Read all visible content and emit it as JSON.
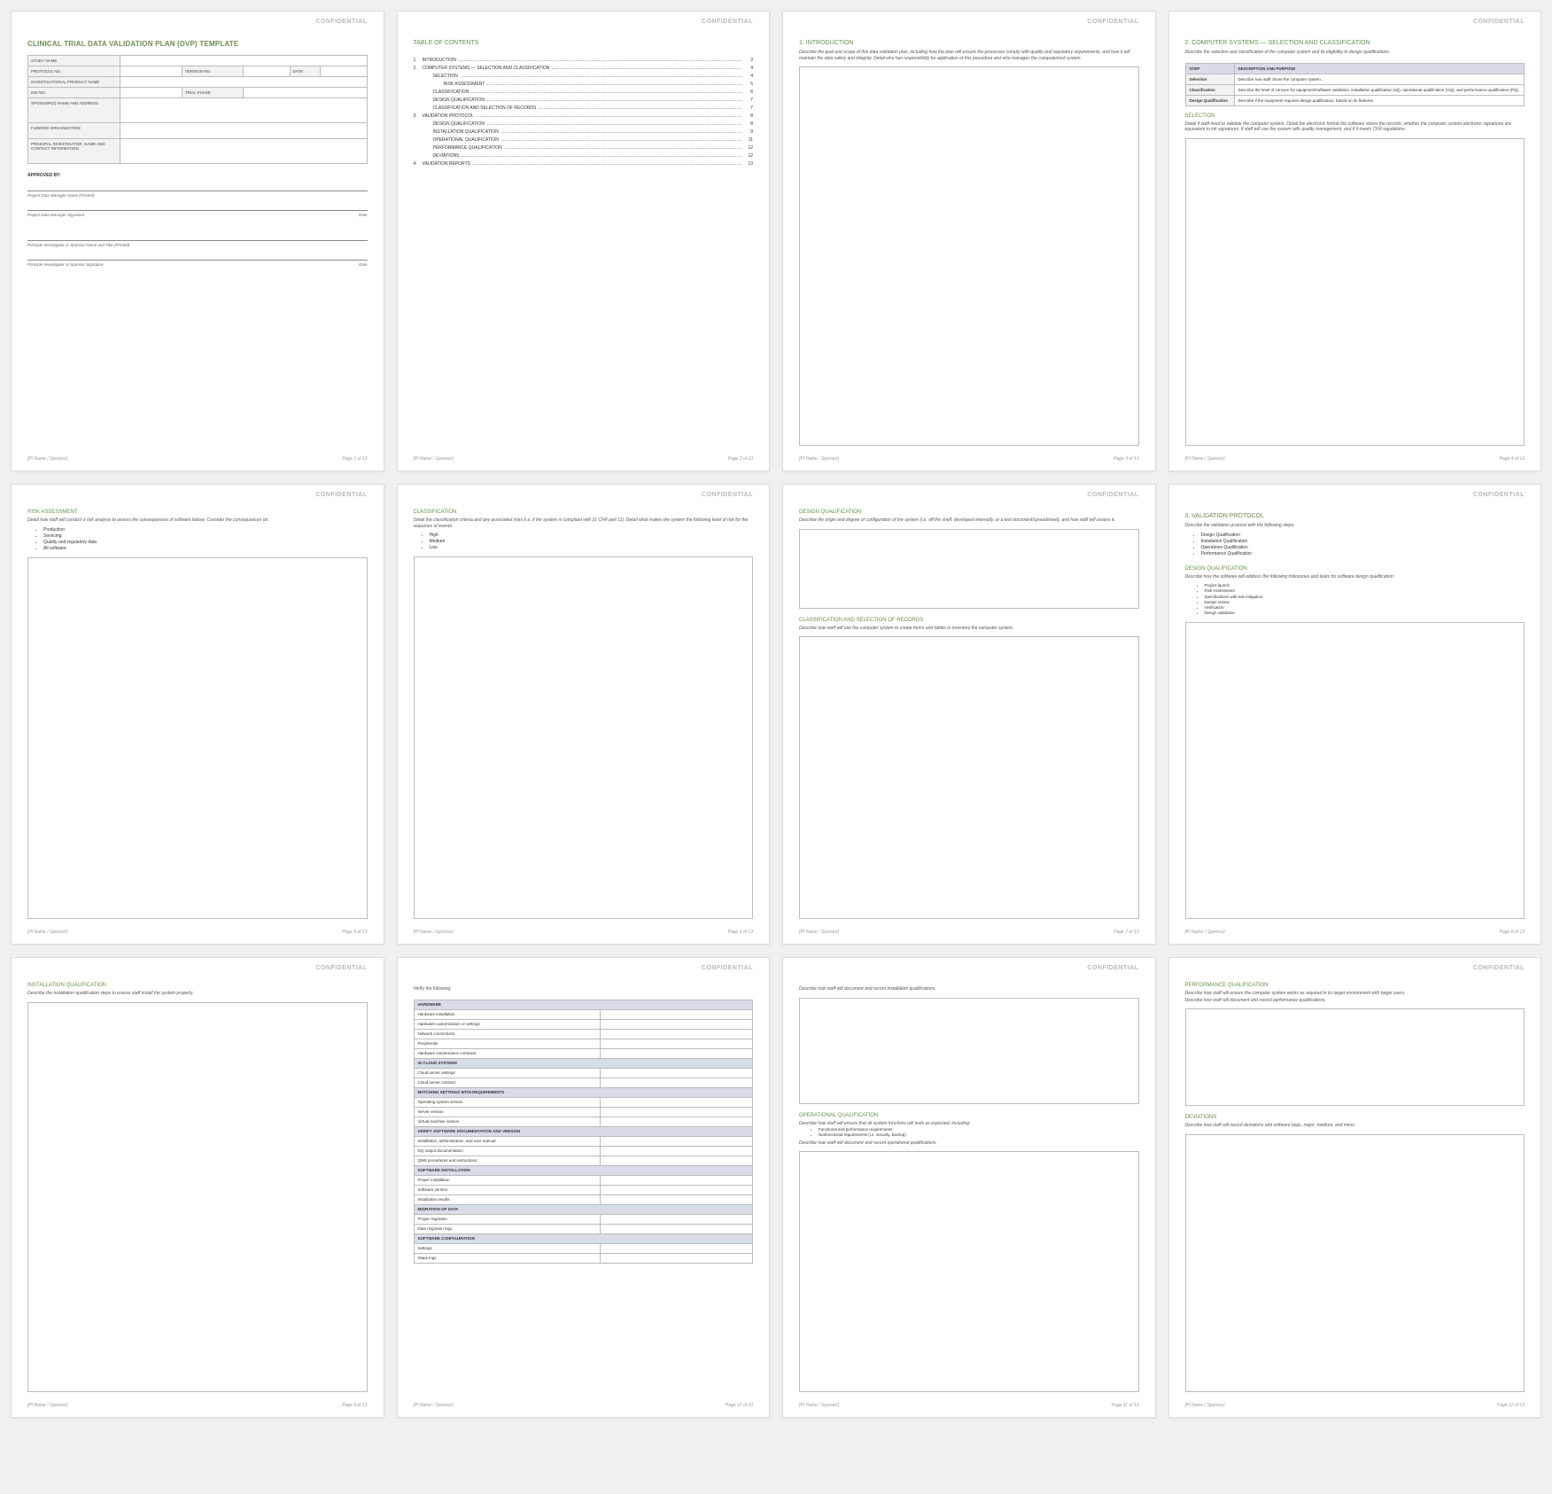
{
  "confidential": "CONFIDENTIAL",
  "footer_left": "[PI Name / Sponsor]",
  "footer_page_prefix": "Page ",
  "footer_page_suffix": " of 13",
  "page1": {
    "title": "CLINICAL TRIAL DATA VALIDATION PLAN (DVP) TEMPLATE",
    "rows": {
      "study_name": "STUDY NAME",
      "protocol_no": "PROTOCOL NO.",
      "version_no": "VERSION NO.",
      "date": "DATE",
      "inv_product": "INVESTIGATIONAL PRODUCT NAME",
      "ind_no": "IND NO.",
      "trial_phase": "TRIAL PHASE",
      "sponsor": "SPONSOR(S) NAME AND ADDRESS",
      "funding": "FUNDING ORGANIZATION",
      "pi": "PRINCIPAL INVESTIGATOR, NAME AND CONTACT INFORMATION"
    },
    "approved_by": "APPROVED BY:",
    "sig1": "Project Data Manager Name (Printed)",
    "sig2": "Project Data Manager Signature",
    "sig3": "Principle Investigator or Sponsor Name and Title (Printed)",
    "sig4": "Principle Investigator or Sponsor Signature",
    "date_lbl": "Date"
  },
  "page2": {
    "title": "TABLE OF CONTENTS",
    "toc": [
      {
        "n": "1.",
        "t": "INTRODUCTION",
        "p": "3",
        "lvl": 0
      },
      {
        "n": "2.",
        "t": "COMPUTER SYSTEMS — SELECTION AND CLASSIFICATION",
        "p": "4",
        "lvl": 0
      },
      {
        "n": "",
        "t": "SELECTION",
        "p": "4",
        "lvl": 1
      },
      {
        "n": "",
        "t": "RISK ASSESSMENT",
        "p": "5",
        "lvl": 2
      },
      {
        "n": "",
        "t": "CLASSIFICATION",
        "p": "6",
        "lvl": 1
      },
      {
        "n": "",
        "t": "DESIGN QUALIFICATION",
        "p": "7",
        "lvl": 1
      },
      {
        "n": "",
        "t": "CLASSIFICATION AND SELECTION OF RECORDS",
        "p": "7",
        "lvl": 1
      },
      {
        "n": "3.",
        "t": "VALIDATION PROTOCOL",
        "p": "8",
        "lvl": 0
      },
      {
        "n": "",
        "t": "DESIGN QUALIFICATION",
        "p": "8",
        "lvl": 1
      },
      {
        "n": "",
        "t": "INSTALLATION QUALIFICATION",
        "p": "9",
        "lvl": 1
      },
      {
        "n": "",
        "t": "OPERATIONAL QUALIFICATION",
        "p": "11",
        "lvl": 1
      },
      {
        "n": "",
        "t": "PERFORMANCE QUALIFICATION",
        "p": "12",
        "lvl": 1
      },
      {
        "n": "",
        "t": "DEVIATIONS",
        "p": "12",
        "lvl": 1
      },
      {
        "n": "4.",
        "t": "VALIDATION REPORTS",
        "p": "13",
        "lvl": 0
      }
    ]
  },
  "page3": {
    "title": "1. INTRODUCTION",
    "desc": "Describe the goal and scope of this data validation plan, including how the plan will ensure the processes comply with quality and regulatory requirements, and how it will maintain the data safety and integrity. Detail who has responsibility for application of this procedure and who manages the computerized system."
  },
  "page4": {
    "title": "2. COMPUTER SYSTEMS — SELECTION AND CLASSIFICATION",
    "desc": "Describe the selection and classification of the computer system and its eligibility to design qualifications.",
    "th1": "STEP",
    "th2": "DESCRIPTION AND PURPOSE",
    "rows": [
      {
        "s": "Selection",
        "d": "Describe how staff chose the computer system."
      },
      {
        "s": "Classification",
        "d": "Describe the level of concern for equipment/software validation: installation qualification (IQ), operational qualification (OQ), and performance qualification (PQ)."
      },
      {
        "s": "Design Qualification",
        "d": "Describe if the equipment requires design qualification, based on its features."
      }
    ],
    "sel_title": "SELECTION",
    "sel_desc": "Detail if staff need to validate the computer system. Detail the electronic format the software stores the records, whether the computer system electronic signatures are equivalent to ink signatures, if staff will use the system with quality management, and if it meets CFR regulations."
  },
  "page5": {
    "title": "RISK ASSESSMENT",
    "desc": "Detail how staff will conduct a risk analysis to assess the consequences of software failure. Consider the consequences on:",
    "items": [
      "Production",
      "Servicing",
      "Quality and regulatory data",
      "All software"
    ]
  },
  "page6": {
    "title": "CLASSIFICATION",
    "desc": "Detail the classification criteria and any associated risks (i.e. if the system is compliant with 21 CFR part 11). Detail what makes the system the following level of risk for the sequence of events:",
    "items": [
      "High",
      "Medium",
      "Low"
    ]
  },
  "page7": {
    "title1": "DESIGN QUALIFICATION",
    "desc1": "Describe the origin and degree of configuration of the system (i.e. off the shelf, developed internally, or a text document/spreadsheet), and how staff will assess it.",
    "title2": "CLASSIFICATION AND SELECTION OF RECORDS",
    "desc2": "Describe how staff will use the computer system to create forms and tables to inventory the computer system."
  },
  "page8": {
    "title": "3. VALIDATION PROTOCOL",
    "desc": "Describe the validation protocol with the following steps:",
    "items": [
      "Design Qualification",
      "Installation Qualification",
      "Operations Qualification",
      "Performance Qualification"
    ],
    "sub_title": "DESIGN QUALIFICATION",
    "sub_desc": "Describe how the software will address the following milestones and tasks for software design qualification:",
    "sub_items": [
      "Project launch",
      "Risk Assessment",
      "Specifications with risk mitigation",
      "Design review",
      "Verification",
      "Design validation"
    ]
  },
  "page9": {
    "title": "INSTALLATION QUALIFICATION",
    "desc": "Describe the installation qualification steps to ensure staff install the system properly."
  },
  "page10": {
    "intro": "Verify the following:",
    "sections": [
      {
        "h": "HARDWARE",
        "rows": [
          "Hardware installation",
          "Hardware customization or settings",
          "Network connections",
          "Peripherals",
          "Hardware maintenance contracts"
        ]
      },
      {
        "h": "IN CLOUD SYSTEMS",
        "rows": [
          "Cloud server settings",
          "Cloud server contract"
        ]
      },
      {
        "h": "MATCHING SETTINGS WITH REQUIREMENTS",
        "rows": [
          "Operating system version",
          "Server version",
          "Virtual-machine version"
        ]
      },
      {
        "h": "VERIFY SOFTWARE DOCUMENTATION AND VERSION",
        "rows": [
          "Installation, administration, and user manual",
          "DQ output documentation",
          "QMS procedures and instructions"
        ]
      },
      {
        "h": "SOFTWARE INSTALLATION",
        "rows": [
          "Proper installation",
          "Software version",
          "Installation results"
        ]
      },
      {
        "h": "MIGRATION OF DATA",
        "rows": [
          "Proper migration",
          "Data migration logs"
        ]
      },
      {
        "h": "SOFTWARE CONFIGURATION",
        "rows": [
          "Settings",
          "Steps logs"
        ]
      }
    ]
  },
  "page11": {
    "desc1": "Describe how staff will document and record installation qualifications.",
    "title2": "OPERATIONAL QUALIFICATION",
    "desc2a": "Describe how staff will ensure that all system functions will work as expected, including:",
    "items": [
      "Functional and performance requirements",
      "Nonfunctional requirements (i.e. security, backup)"
    ],
    "desc2b": "Describe how staff will document and record operational qualifications."
  },
  "page12": {
    "title1": "PERFORMANCE QUALIFICATION",
    "desc1a": "Describe how staff will ensure the computer system works as required in its target environment with target users.",
    "desc1b": "Describe how staff will document and record performance qualifications.",
    "title2": "DEVIATIONS",
    "desc2": "Describe how staff will record deviations and software bugs, major, medium, and minor."
  }
}
